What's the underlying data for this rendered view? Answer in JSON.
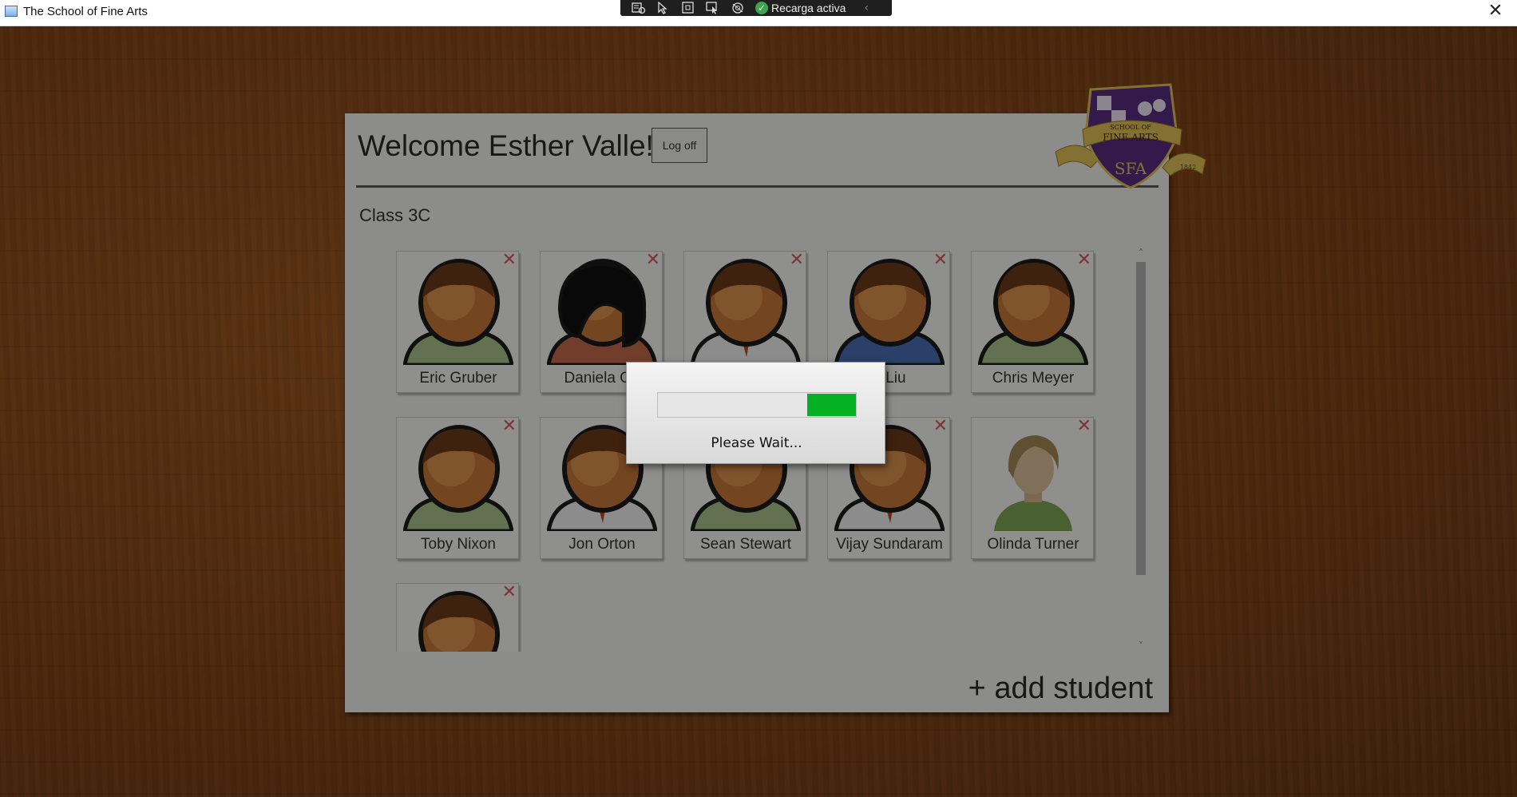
{
  "window": {
    "title": "The School of Fine Arts",
    "close_glyph": "✕",
    "app_icon": "window-app-icon"
  },
  "devtools_bar": {
    "icons": [
      "live-visual-tree-icon",
      "select-element-icon",
      "display-layout-adorners-icon",
      "track-focused-element-icon",
      "binding-failures-icon"
    ],
    "status": "Recarga activa",
    "collapse_glyph": "‹"
  },
  "header": {
    "welcome": "Welcome Esther Valle!",
    "logoff_label": "Log off"
  },
  "class_name": "Class 3C",
  "students": [
    {
      "name": "Eric Gruber",
      "avatar": "male"
    },
    {
      "name": "Daniela Gu",
      "avatar": "female-dark"
    },
    {
      "name": "",
      "avatar": "male-tie"
    },
    {
      "name": "n Liu",
      "avatar": "male-sweater"
    },
    {
      "name": "Chris Meyer",
      "avatar": "male"
    },
    {
      "name": "Toby Nixon",
      "avatar": "male"
    },
    {
      "name": "Jon Orton",
      "avatar": "male-tie"
    },
    {
      "name": "Sean Stewart",
      "avatar": "male"
    },
    {
      "name": "Vijay Sundaram",
      "avatar": "male-tie"
    },
    {
      "name": "Olinda Turner",
      "avatar": "female-photo"
    },
    {
      "name": "",
      "avatar": "male"
    }
  ],
  "remove_glyph": "✕",
  "scroll": {
    "up_glyph": "˄",
    "down_glyph": "˅"
  },
  "add_student_label": "+ add student",
  "crest": {
    "line1": "SCHOOL OF",
    "line2": "FINE ARTS",
    "monogram": "SFA",
    "year": "1842"
  },
  "loading_dialog": {
    "message": "Please Wait...",
    "indeterminate": true
  },
  "colors": {
    "progress_fill": "#06b025",
    "crest_purple": "#5a2d82",
    "crest_gold": "#e2c35a",
    "remove_x": "#d35a5a"
  }
}
